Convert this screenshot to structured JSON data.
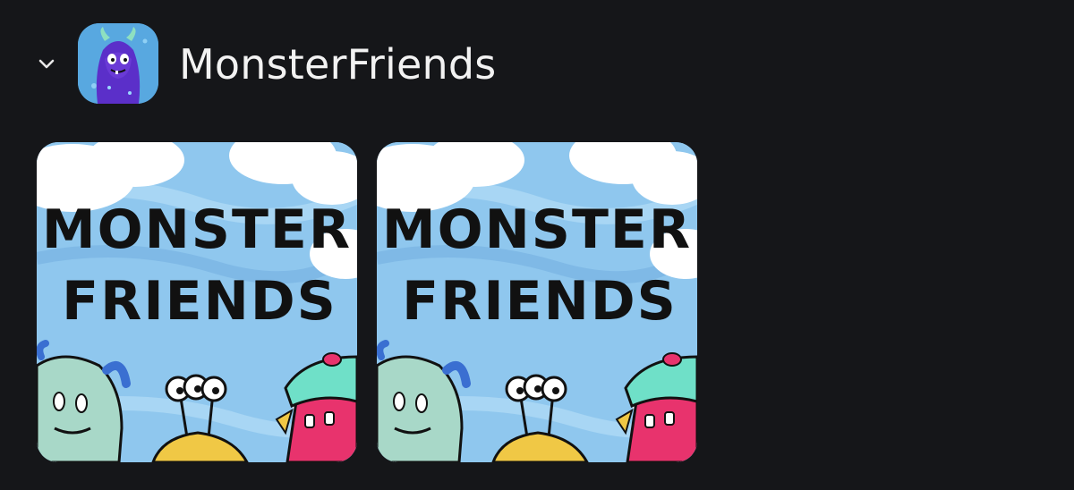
{
  "group": {
    "collapse_icon": "chevron-down-icon",
    "avatar_icon": "purple-monster-avatar",
    "title": "MonsterFriends"
  },
  "thumbnails": [
    {
      "logo_line1": "MONSTER",
      "logo_line2": "FRIENDS"
    },
    {
      "logo_line1": "MONSTER",
      "logo_line2": "FRIENDS"
    }
  ],
  "colors": {
    "background": "#151619",
    "title_text": "#f2f2f2",
    "sky": "#8fc7ee",
    "cloud": "#ffffff",
    "logo_ink": "#111111"
  }
}
